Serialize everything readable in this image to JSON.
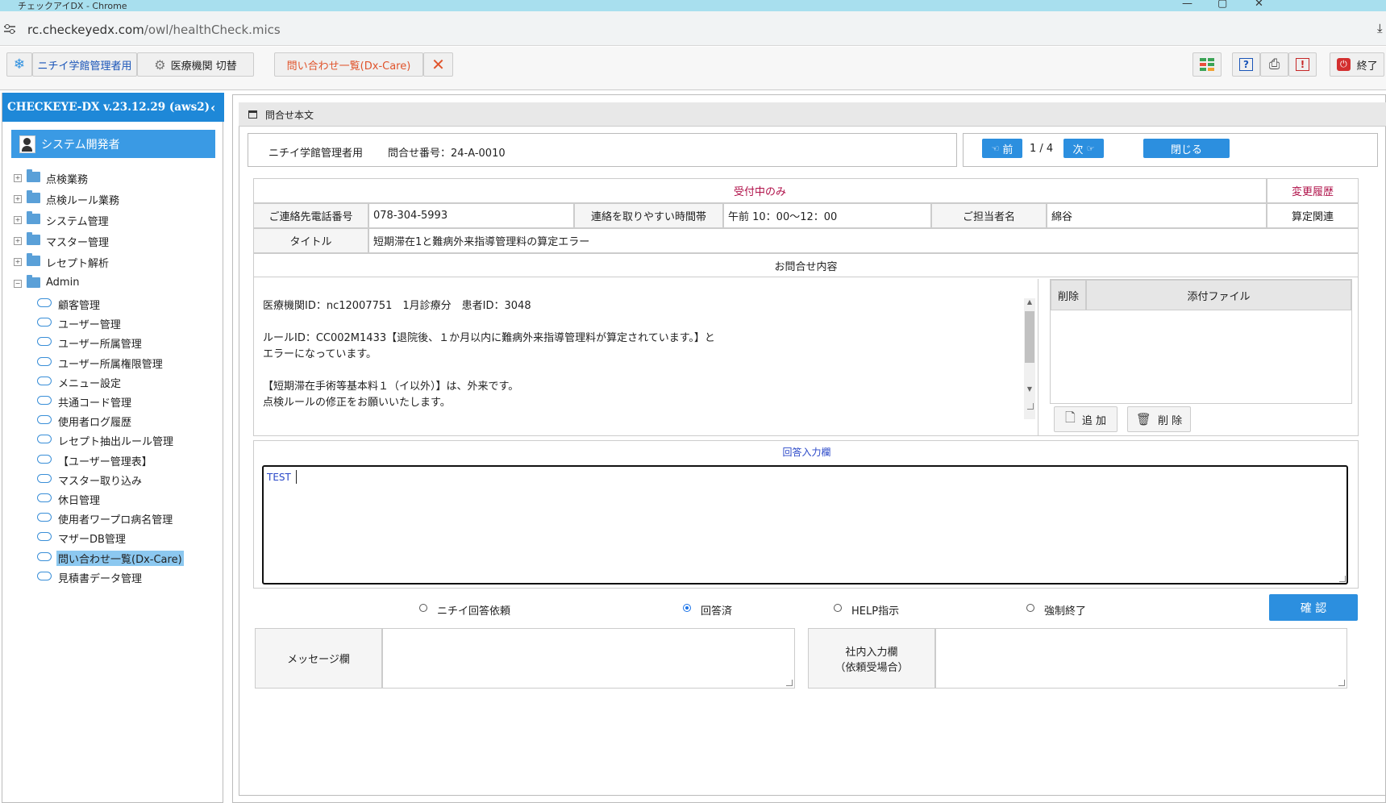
{
  "window": {
    "title": "チェックアイDX - Chrome",
    "url_host": "rc.checkeyedx.com",
    "url_path": "/owl/healthCheck.mics"
  },
  "toolbar": {
    "user_button": "ニチイ学館管理者用",
    "switch_button": "医療機関 切替",
    "tab_label": "問い合わせ一覧(Dx-Care)",
    "exit_label": "終了"
  },
  "sidebar": {
    "version": "CHECKEYE-DX v.23.12.29 (aws2)",
    "user": "システム開発者",
    "folders": [
      "点検業務",
      "点検ルール業務",
      "システム管理",
      "マスター管理",
      "レセプト解析",
      "Admin"
    ],
    "admin_items": [
      "顧客管理",
      "ユーザー管理",
      "ユーザー所属管理",
      "ユーザー所属権限管理",
      "メニュー設定",
      "共通コード管理",
      "使用者ログ履歴",
      "レセプト抽出ルール管理",
      "【ユーザー管理表】",
      "マスター取り込み",
      "休日管理",
      "使用者ワープロ病名管理",
      "マザーDB管理",
      "問い合わせ一覧(Dx-Care)",
      "見積書データ管理"
    ],
    "selected_index": 13
  },
  "panel": {
    "title": "問合せ本文",
    "org": "ニチイ学館管理者用",
    "inquiry_no": "問合せ番号：24-A-0010",
    "prev": "前",
    "page": "1 / 4",
    "next": "次",
    "close": "閉じる"
  },
  "form": {
    "status": "受付中のみ",
    "history": "変更履歴",
    "phone_label": "ご連絡先電話番号",
    "phone": "078-304-5993",
    "time_label": "連絡を取りやすい時間帯",
    "time": "午前 10：00～12：00",
    "person_label": "ご担当者名",
    "person": "綿谷",
    "category": "算定関連",
    "title_label": "タイトル",
    "title": "短期滞在1と難病外来指導管理料の算定エラー",
    "content_label": "お問合せ内容",
    "content_lines": [
      "医療機関ID：nc12007751　1月診療分　患者ID：3048",
      "",
      "ルールID：CC002M1433【退院後、１か月以内に難病外来指導管理料が算定されています。】と",
      "エラーになっています。",
      "",
      "【短期滞在手術等基本料１（イ以外）】は、外来です。",
      "点検ルールの修正をお願いいたします。"
    ],
    "attach_delete_col": "削除",
    "attach_file_col": "添付ファイル",
    "add_button": "追 加",
    "delete_button": "削 除",
    "answer_label": "回答入力欄",
    "answer_text": "TEST",
    "radios": [
      "ニチイ回答依頼",
      "回答済",
      "HELP指示",
      "強制終了"
    ],
    "radio_selected": 1,
    "confirm": "確 認",
    "message_label": "メッセージ欄",
    "internal_label_1": "社内入力欄",
    "internal_label_2": "（依頼受場合）"
  },
  "colors": {
    "accent": "#1e88d8",
    "selected": "#8cc8f0",
    "danger": "#e0542c"
  }
}
